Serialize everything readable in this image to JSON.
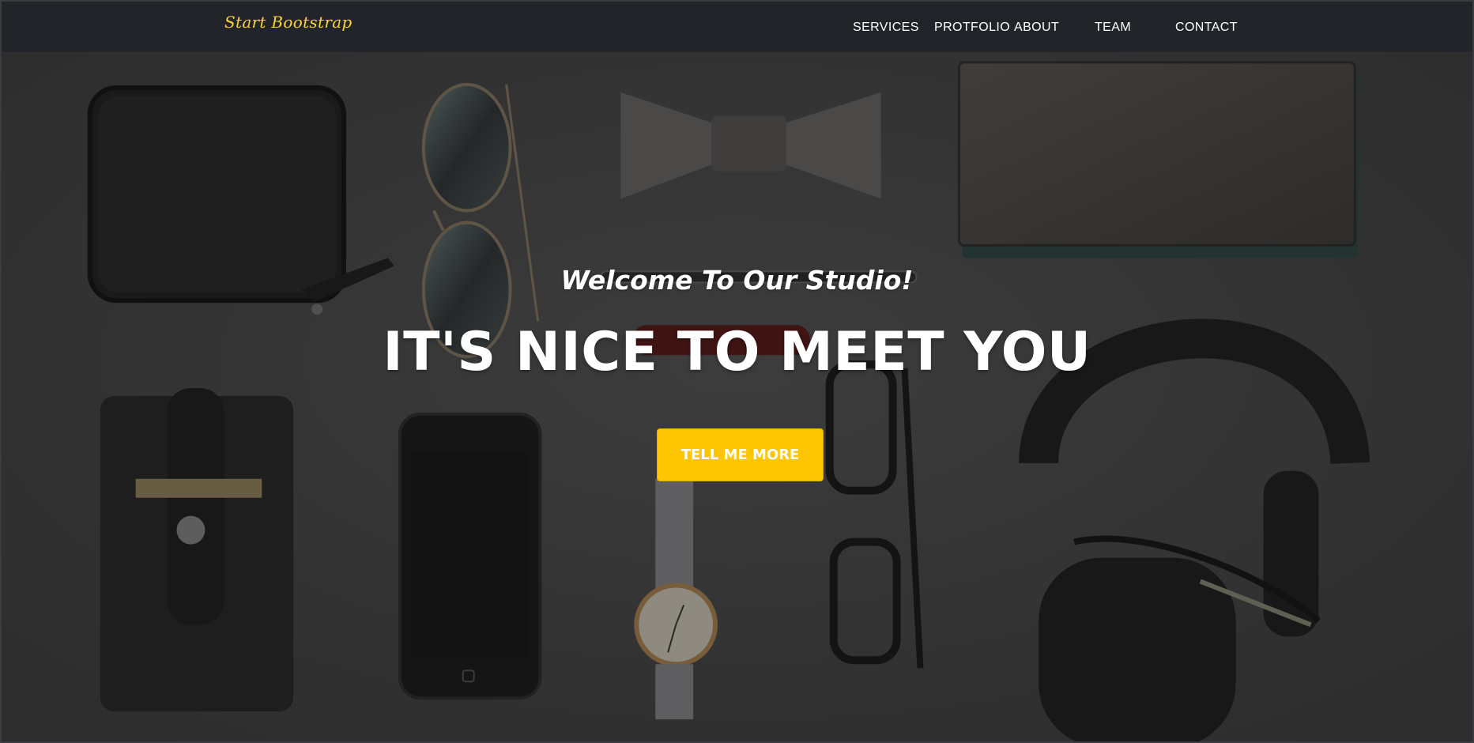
{
  "navbar": {
    "brand": "Start Bootstrap",
    "items": [
      {
        "label": "SERVICES"
      },
      {
        "label": "PROTFOLIO"
      },
      {
        "label": "ABOUT"
      },
      {
        "label": "TEAM"
      },
      {
        "label": "CONTACT"
      }
    ]
  },
  "hero": {
    "welcome_text": "Welcome To Our Studio!",
    "headline": "IT'S NICE TO MEET YOU",
    "cta_label": "TELL ME MORE"
  },
  "colors": {
    "navbar_bg": "#212529",
    "brand": "#fed136",
    "cta_bg": "#fec503",
    "text": "#ffffff"
  }
}
